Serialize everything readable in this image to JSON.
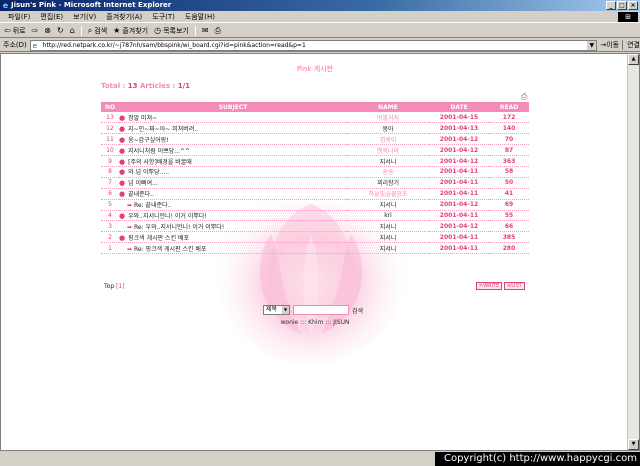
{
  "window": {
    "title": "Jisun's Pink - Microsoft Internet Explorer"
  },
  "menu": {
    "items": [
      "파일(F)",
      "편집(E)",
      "보기(V)",
      "즐겨찾기(A)",
      "도구(T)",
      "도움말(H)"
    ]
  },
  "toolbar": {
    "back": "뒤로",
    "search": "검색",
    "favorites": "즐겨찾기",
    "history": "목록보기"
  },
  "address": {
    "label": "주소(D)",
    "url": "http://red.netpark.co.kr/~j787nh/sam/bbspink/wi_board.cgi?id=pink&action=read&p=1",
    "go": "이동",
    "links": "연결"
  },
  "board": {
    "title": "Pink 게시판",
    "total_prefix": "Total : ",
    "total_count": "13",
    "total_articles": " Articles : ",
    "page": "1/1",
    "headers": {
      "no": "NO",
      "subject": "SUBJECT",
      "name": "NAME",
      "date": "DATE",
      "read": "READ"
    },
    "rows": [
      {
        "no": "13",
        "subject": "정말 미쳐~",
        "reply": false,
        "name": "버블거지",
        "name_pink": true,
        "date": "2001-04-15",
        "read": "172"
      },
      {
        "no": "12",
        "subject": "지~인~짜~아~ 미쳐버려..",
        "reply": false,
        "name": "뭉아",
        "name_pink": false,
        "date": "2001-04-13",
        "read": "140"
      },
      {
        "no": "11",
        "subject": "웅~감구싶어랑!",
        "reply": false,
        "name": "겸쑥이",
        "name_pink": true,
        "date": "2001-04-12",
        "read": "70"
      },
      {
        "no": "10",
        "subject": "지서니처럼 이쁘당...^^",
        "reply": false,
        "name": "행복나라",
        "name_pink": true,
        "date": "2001-04-12",
        "read": "87"
      },
      {
        "no": "9",
        "subject": "[주의 사항]배경을 바꿀때",
        "reply": false,
        "name": "지서니",
        "name_pink": false,
        "date": "2001-04-12",
        "read": "363"
      },
      {
        "no": "8",
        "subject": "와 넘 이뿌당.....",
        "reply": false,
        "name": "숑숑",
        "name_pink": true,
        "date": "2001-04-11",
        "read": "58"
      },
      {
        "no": "7",
        "subject": "넘 이뻐여...",
        "reply": false,
        "name": "꾀리향기",
        "name_pink": false,
        "date": "2001-04-11",
        "read": "50"
      },
      {
        "no": "6",
        "subject": "끝내준다..",
        "reply": false,
        "name": "하늘빛@물망초",
        "name_pink": true,
        "date": "2001-04-11",
        "read": "41"
      },
      {
        "no": "5",
        "subject": "Re: 끝내준다..",
        "reply": true,
        "name": "지서니",
        "name_pink": false,
        "date": "2001-04-12",
        "read": "69"
      },
      {
        "no": "4",
        "subject": "우와..지서니언니! 이거 이뿌다!",
        "reply": false,
        "name": "kri",
        "name_pink": false,
        "date": "2001-04-11",
        "read": "55"
      },
      {
        "no": "3",
        "subject": "Re: 우와..지서니언니! 이거 이뿌다!",
        "reply": true,
        "name": "지서니",
        "name_pink": false,
        "date": "2001-04-12",
        "read": "66"
      },
      {
        "no": "2",
        "subject": "핑크색 게시판 스킨 배포",
        "reply": false,
        "name": "지서니",
        "name_pink": false,
        "date": "2001-04-11",
        "read": "385"
      },
      {
        "no": "1",
        "subject": "Re: 핑크색 게시판 스킨 배포",
        "reply": true,
        "name": "지서니",
        "name_pink": false,
        "date": "2001-04-11",
        "read": "280"
      }
    ],
    "top_label": "Top",
    "page_link": "[1]",
    "write_label": "WRITE",
    "list_label": "LIST"
  },
  "search": {
    "select_value": "제목",
    "button": "검색"
  },
  "credits": "wonie ::: Khim ::: JISUN",
  "footer": {
    "copyright": "Copyright(c) http://www.happycgi.com"
  },
  "colors": {
    "header_pink": "#f58cb8",
    "accent": "#e0407d"
  }
}
